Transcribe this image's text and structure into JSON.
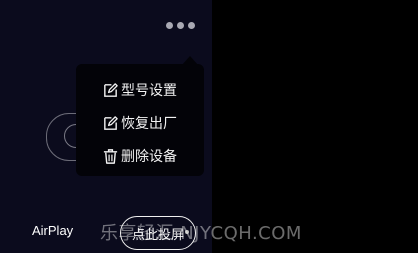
{
  "menu": {
    "items": [
      {
        "label": "型号设置",
        "icon": "edit-icon"
      },
      {
        "label": "恢复出厂",
        "icon": "edit-icon"
      },
      {
        "label": "删除设备",
        "icon": "trash-icon"
      }
    ]
  },
  "bottom": {
    "airplay_label": "AirPlay",
    "cast_label": "点此投屏"
  },
  "watermark": {
    "text": "乐享轻汇 NJYCQH.COM"
  },
  "colors": {
    "panel_bg": "#0b0b1d",
    "menu_bg": "#030308",
    "text": "#f2f2f2"
  }
}
